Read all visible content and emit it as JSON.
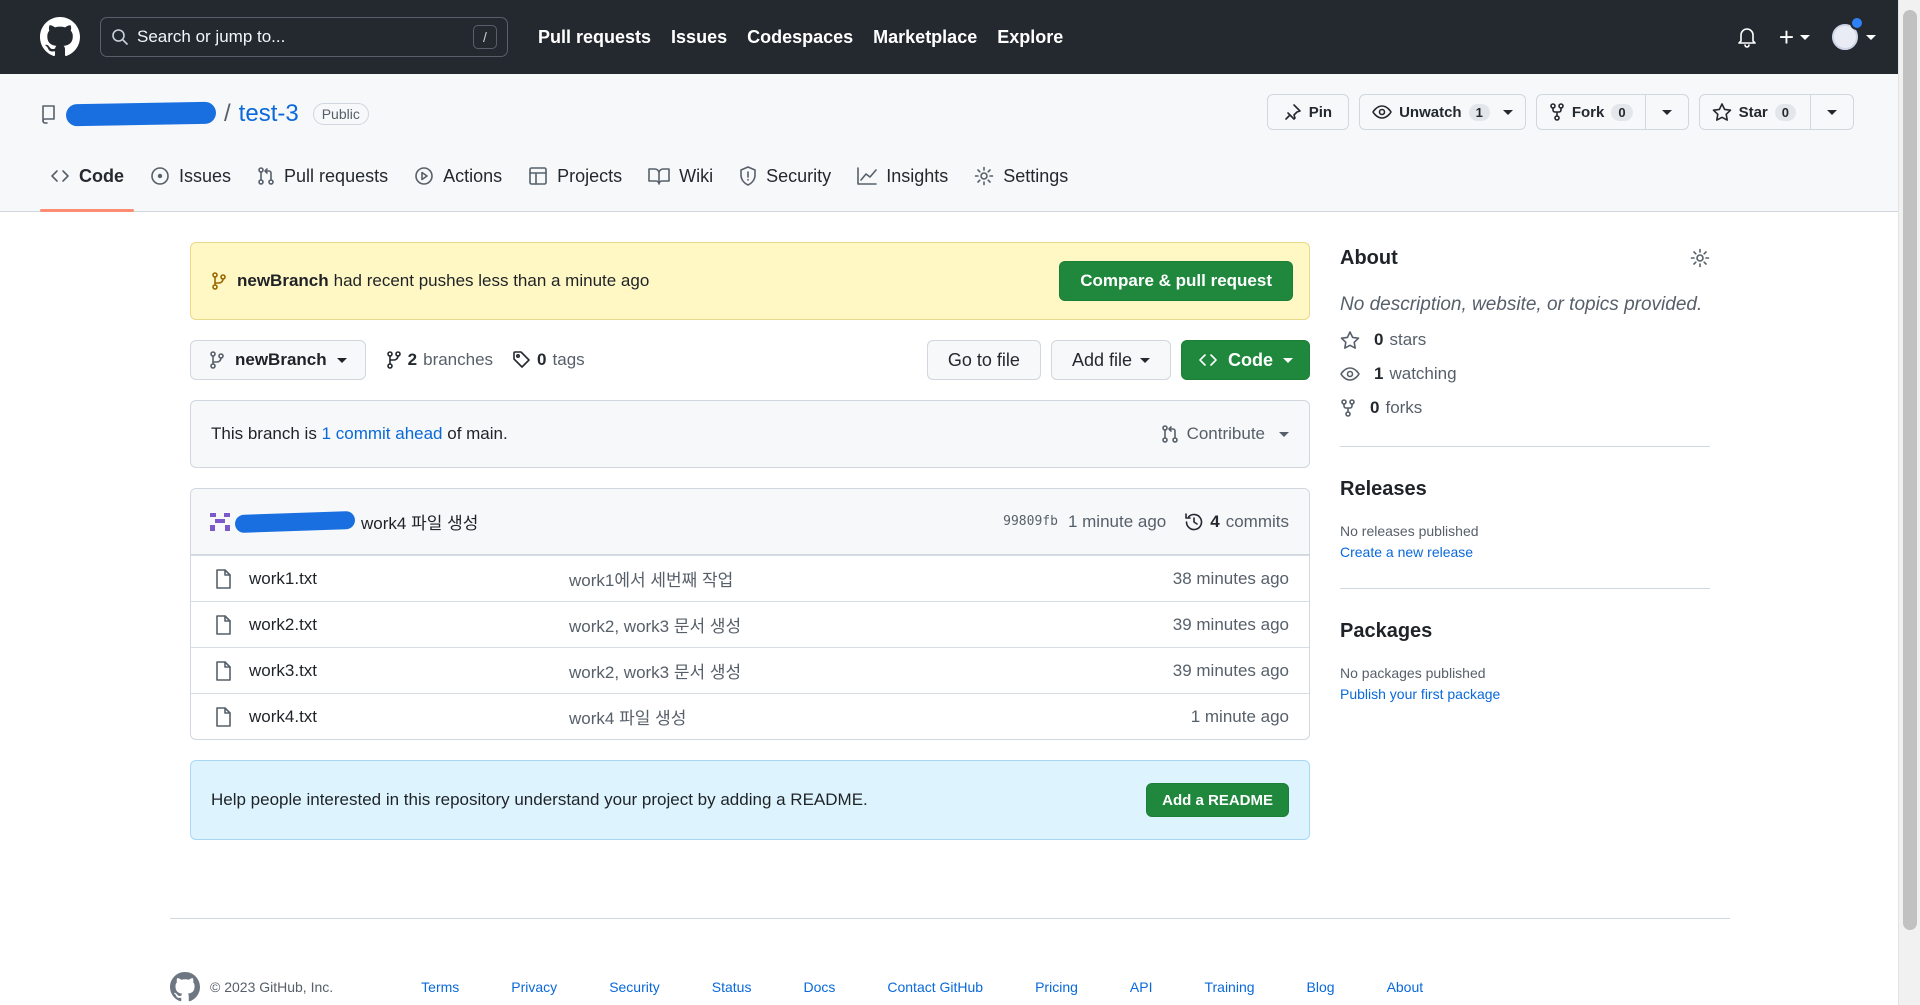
{
  "header": {
    "search_placeholder": "Search or jump to...",
    "search_shortcut": "/",
    "nav": [
      "Pull requests",
      "Issues",
      "Codespaces",
      "Marketplace",
      "Explore"
    ],
    "plus_label": "+"
  },
  "repo": {
    "separator": "/",
    "name": "test-3",
    "visibility": "Public",
    "pin_label": "Pin",
    "watch_label": "Unwatch",
    "watch_count": "1",
    "fork_label": "Fork",
    "fork_count": "0",
    "star_label": "Star",
    "star_count": "0"
  },
  "tabs": [
    {
      "label": "Code",
      "icon": "code-icon",
      "active": true
    },
    {
      "label": "Issues",
      "icon": "issue-icon"
    },
    {
      "label": "Pull requests",
      "icon": "pull-request-icon"
    },
    {
      "label": "Actions",
      "icon": "play-icon"
    },
    {
      "label": "Projects",
      "icon": "table-icon"
    },
    {
      "label": "Wiki",
      "icon": "book-icon"
    },
    {
      "label": "Security",
      "icon": "shield-icon"
    },
    {
      "label": "Insights",
      "icon": "graph-icon"
    },
    {
      "label": "Settings",
      "icon": "gear-icon"
    }
  ],
  "flash": {
    "branch": "newBranch",
    "text": "had recent pushes less than a minute ago",
    "button": "Compare & pull request"
  },
  "file_nav": {
    "branch": "newBranch",
    "branches_count": "2",
    "branches_label": "branches",
    "tags_count": "0",
    "tags_label": "tags",
    "goto_file": "Go to file",
    "add_file": "Add file",
    "code": "Code"
  },
  "branch_info": {
    "prefix": "This branch is",
    "link": "1 commit ahead",
    "suffix": "of main.",
    "contribute": "Contribute"
  },
  "latest_commit": {
    "message": "work4 파일 생성",
    "sha": "99809fb",
    "time": "1 minute ago",
    "commits_count": "4",
    "commits_label": "commits"
  },
  "files": [
    {
      "name": "work1.txt",
      "message": "work1에서 세번째 작업",
      "age": "38 minutes ago"
    },
    {
      "name": "work2.txt",
      "message": "work2, work3 문서 생성",
      "age": "39 minutes ago"
    },
    {
      "name": "work3.txt",
      "message": "work2, work3 문서 생성",
      "age": "39 minutes ago"
    },
    {
      "name": "work4.txt",
      "message": "work4 파일 생성",
      "age": "1 minute ago"
    }
  ],
  "readme": {
    "text": "Help people interested in this repository understand your project by adding a README.",
    "button": "Add a README"
  },
  "about": {
    "title": "About",
    "description": "No description, website, or topics provided.",
    "stars_count": "0",
    "stars_label": "stars",
    "watching_count": "1",
    "watching_label": "watching",
    "forks_count": "0",
    "forks_label": "forks"
  },
  "releases": {
    "title": "Releases",
    "empty": "No releases published",
    "link": "Create a new release"
  },
  "packages": {
    "title": "Packages",
    "empty": "No packages published",
    "link": "Publish your first package"
  },
  "footer": {
    "copyright": "© 2023 GitHub, Inc.",
    "links": [
      "Terms",
      "Privacy",
      "Security",
      "Status",
      "Docs",
      "Contact GitHub",
      "Pricing",
      "API",
      "Training",
      "Blog",
      "About"
    ]
  },
  "colors": {
    "header_bg": "#24292f",
    "accent_green": "#1f883d",
    "link_blue": "#0969da",
    "flash_bg": "#fff8c5",
    "readme_bg": "#ddf4ff",
    "tab_underline": "#fd8c73"
  }
}
